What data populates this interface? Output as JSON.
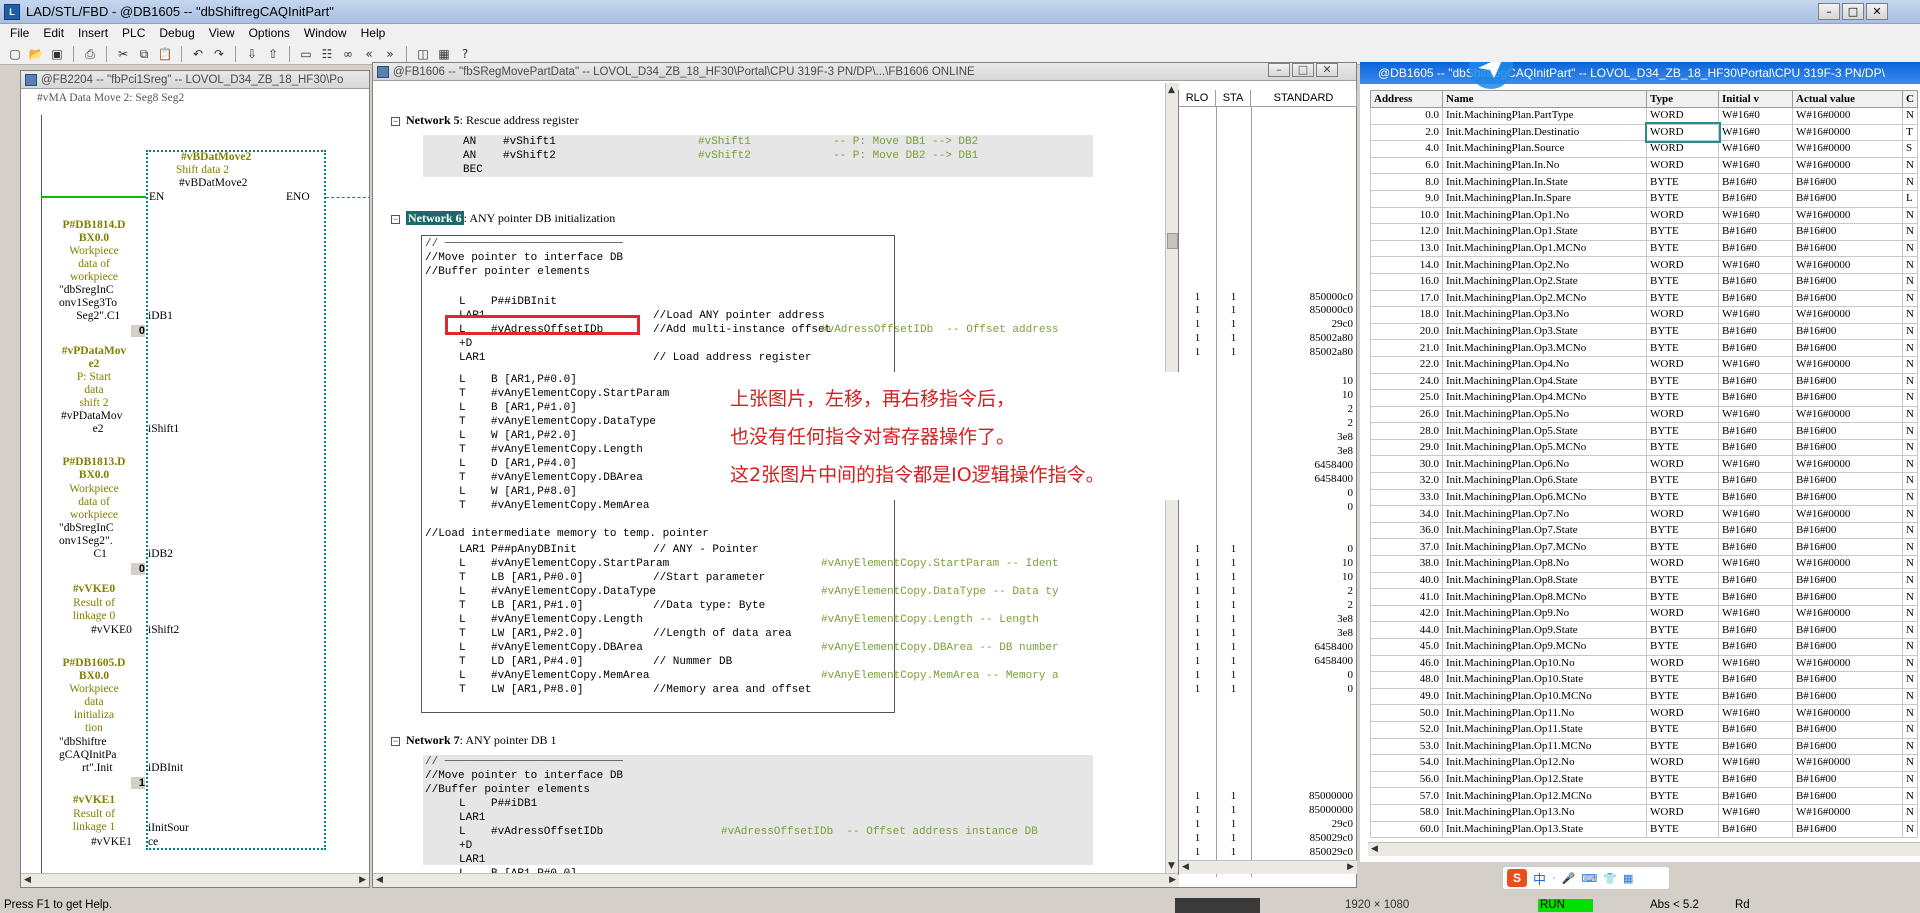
{
  "app": {
    "title": "LAD/STL/FBD  - @DB1605 -- \"dbShiftregCAQInitPart\""
  },
  "menu": [
    "File",
    "Edit",
    "Insert",
    "PLC",
    "Debug",
    "View",
    "Options",
    "Window",
    "Help"
  ],
  "left_panel": {
    "title": "@FB2204 -- \"fbPci1Sreg\" -- LOVOL_D34_ZB_18_HF30\\Po",
    "top_text": "#vMA Data Move 2: Seg8 Seg2",
    "block_name": "#vBDatMove2",
    "block_comment": "Shift data 2",
    "block_instance": "#vBDatMove2",
    "en": "EN",
    "eno": "ENO",
    "inputs": [
      {
        "symbol_lines": [
          "P#DB1814.D",
          "BX0.0"
        ],
        "comment_lines": [
          "Workpiece",
          "data of",
          "workpiece"
        ],
        "value_lines": [
          "\"dbSregInC",
          "onv1Seg3To",
          "Seg2\".C1"
        ],
        "pin": "iDB1",
        "extra": "0"
      },
      {
        "symbol_lines": [
          "#vPDataMov",
          "e2"
        ],
        "comment_lines": [
          "P: Start",
          "data",
          "shift 2"
        ],
        "value_lines": [
          "#vPDataMov",
          "e2"
        ],
        "pin": "iShift1",
        "extra": ""
      },
      {
        "symbol_lines": [
          "P#DB1813.D",
          "BX0.0"
        ],
        "comment_lines": [
          "Workpiece",
          "data of",
          "workpiece"
        ],
        "value_lines": [
          "\"dbSregInC",
          "onv1Seg2\".",
          "C1"
        ],
        "pin": "iDB2",
        "extra": "0"
      },
      {
        "symbol_lines": [
          "#vVKE0"
        ],
        "comment_lines": [
          "Result of",
          "linkage 0"
        ],
        "value_lines": [
          "#vVKE0"
        ],
        "pin": "iShift2",
        "extra": ""
      },
      {
        "symbol_lines": [
          "P#DB1605.D",
          "BX0.0"
        ],
        "comment_lines": [
          "Workpiece",
          "data",
          "initializa",
          "tion"
        ],
        "value_lines": [
          "\"dbShiftre",
          "gCAQInitPa",
          "rt\".Init"
        ],
        "pin": "iDBInit",
        "extra": "1"
      },
      {
        "symbol_lines": [
          "#vVKE1"
        ],
        "comment_lines": [
          "Result of",
          "linkage 1"
        ],
        "value_lines": [
          "#vVKE1"
        ],
        "pin": "iInitSour",
        "extra": "ce"
      }
    ]
  },
  "code_panel": {
    "title": "@FB1606 -- \"fbSRegMovePartData\" -- LOVOL_D34_ZB_18_HF30\\Portal\\CPU 319F-3 PN/DP\\...\\FB1606  ONLINE",
    "status_headers": [
      "RLO",
      "STA",
      "STANDARD"
    ],
    "network5": {
      "label": "Network 5",
      "title": ": Rescue address register",
      "lines": [
        {
          "op": "AN",
          "arg": "#vShift1",
          "sym": "#vShift1",
          "cmt": "-- P: Move DB1 --> DB2"
        },
        {
          "op": "AN",
          "arg": "#vShift2",
          "sym": "#vShift2",
          "cmt": "-- P: Move DB2 --> DB1"
        },
        {
          "op": "BEC",
          "arg": "",
          "sym": "",
          "cmt": ""
        }
      ]
    },
    "network6": {
      "label": "Network 6",
      "title": ": ANY pointer DB initialization",
      "comment_lines": [
        "// ───────────────────────────",
        "//Move pointer to interface DB",
        "//Buffer pointer elements"
      ],
      "lines": [
        {
          "op": "L",
          "arg": "P##iDBInit",
          "cmt": "",
          "sym": ""
        },
        {
          "op": "LAR1",
          "arg": "",
          "cmt": "//Load ANY pointer address",
          "sym": ""
        },
        {
          "op": "L",
          "arg": "#vAdressOffsetIDb",
          "cmt": "//Add multi-instance offset",
          "sym": "#vAdressOffsetIDb  -- Offset address"
        },
        {
          "op": "+D",
          "arg": "",
          "cmt": "",
          "sym": ""
        },
        {
          "op": "LAR1",
          "arg": "",
          "cmt": "// Load address register",
          "sym": ""
        },
        {
          "op": "L",
          "arg": "B [AR1,P#0.0]",
          "cmt": "",
          "sym": ""
        },
        {
          "op": "T",
          "arg": "#vAnyElementCopy.StartParam",
          "cmt": "",
          "sym": ""
        },
        {
          "op": "L",
          "arg": "B [AR1,P#1.0]",
          "cmt": "",
          "sym": ""
        },
        {
          "op": "T",
          "arg": "#vAnyElementCopy.DataType",
          "cmt": "",
          "sym": ""
        },
        {
          "op": "L",
          "arg": "W [AR1,P#2.0]",
          "cmt": "",
          "sym": ""
        },
        {
          "op": "T",
          "arg": "#vAnyElementCopy.Length",
          "cmt": "",
          "sym": ""
        },
        {
          "op": "L",
          "arg": "D [AR1,P#4.0]",
          "cmt": "",
          "sym": ""
        },
        {
          "op": "T",
          "arg": "#vAnyElementCopy.DBArea",
          "cmt": "",
          "sym": ""
        },
        {
          "op": "L",
          "arg": "W [AR1,P#8.0]",
          "cmt": "",
          "sym": ""
        },
        {
          "op": "T",
          "arg": "#vAnyElementCopy.MemArea",
          "cmt": "",
          "sym": ""
        }
      ],
      "comment2": "//Load intermediate memory to temp. pointer",
      "lines2": [
        {
          "op": "LAR1",
          "arg": "P##pAnyDBInit",
          "cmt": "// ANY - Pointer",
          "sym": ""
        },
        {
          "op": "L",
          "arg": "#vAnyElementCopy.StartParam",
          "cmt": "",
          "sym": "#vAnyElementCopy.StartParam -- Ident"
        },
        {
          "op": "T",
          "arg": "LB [AR1,P#0.0]",
          "cmt": "//Start parameter",
          "sym": ""
        },
        {
          "op": "L",
          "arg": "#vAnyElementCopy.DataType",
          "cmt": "",
          "sym": "#vAnyElementCopy.DataType -- Data ty"
        },
        {
          "op": "T",
          "arg": "LB [AR1,P#1.0]",
          "cmt": "//Data type: Byte",
          "sym": ""
        },
        {
          "op": "L",
          "arg": "#vAnyElementCopy.Length",
          "cmt": "",
          "sym": "#vAnyElementCopy.Length -- Length"
        },
        {
          "op": "T",
          "arg": "LW [AR1,P#2.0]",
          "cmt": "//Length of data area",
          "sym": ""
        },
        {
          "op": "L",
          "arg": "#vAnyElementCopy.DBArea",
          "cmt": "",
          "sym": "#vAnyElementCopy.DBArea -- DB number"
        },
        {
          "op": "T",
          "arg": "LD [AR1,P#4.0]",
          "cmt": "// Nummer DB",
          "sym": ""
        },
        {
          "op": "L",
          "arg": "#vAnyElementCopy.MemArea",
          "cmt": "",
          "sym": "#vAnyElementCopy.MemArea -- Memory a"
        },
        {
          "op": "T",
          "arg": "LW [AR1,P#8.0]",
          "cmt": "//Memory area and offset",
          "sym": ""
        }
      ]
    },
    "network7": {
      "label": "Network 7",
      "title": ": ANY pointer DB 1",
      "comment_lines": [
        "// ───────────────────────────",
        "//Move pointer to interface DB",
        "//Buffer pointer elements"
      ],
      "lines": [
        {
          "op": "L",
          "arg": "P##iDB1",
          "sym": ""
        },
        {
          "op": "LAR1",
          "arg": "",
          "sym": ""
        },
        {
          "op": "L",
          "arg": "#vAdressOffsetIDb",
          "sym": "#vAdressOffsetIDb  -- Offset address instance DB"
        },
        {
          "op": "+D",
          "arg": "",
          "sym": ""
        },
        {
          "op": "LAR1",
          "arg": "",
          "sym": ""
        },
        {
          "op": "L",
          "arg": "B [AR1,P#0.0]",
          "sym": ""
        }
      ]
    },
    "status_rows": [
      {
        "rlo": "1",
        "sta": "1",
        "std": "850000c0"
      },
      {
        "rlo": "1",
        "sta": "1",
        "std": "850000c0"
      },
      {
        "rlo": "1",
        "sta": "1",
        "std": "29c0"
      },
      {
        "rlo": "1",
        "sta": "1",
        "std": "85002a80"
      },
      {
        "rlo": "1",
        "sta": "1",
        "std": "85002a80"
      },
      {
        "rlo": "",
        "sta": "",
        "std": "10"
      },
      {
        "rlo": "",
        "sta": "",
        "std": "10"
      },
      {
        "rlo": "",
        "sta": "",
        "std": "2"
      },
      {
        "rlo": "",
        "sta": "",
        "std": "2"
      },
      {
        "rlo": "",
        "sta": "",
        "std": "3e8"
      },
      {
        "rlo": "",
        "sta": "",
        "std": "3e8"
      },
      {
        "rlo": "",
        "sta": "",
        "std": "6458400"
      },
      {
        "rlo": "",
        "sta": "",
        "std": "6458400"
      },
      {
        "rlo": "",
        "sta": "",
        "std": "0"
      },
      {
        "rlo": "",
        "sta": "",
        "std": "0"
      },
      {
        "rlo": "1",
        "sta": "1",
        "std": "0"
      },
      {
        "rlo": "1",
        "sta": "1",
        "std": "10"
      },
      {
        "rlo": "1",
        "sta": "1",
        "std": "10"
      },
      {
        "rlo": "1",
        "sta": "1",
        "std": "2"
      },
      {
        "rlo": "1",
        "sta": "1",
        "std": "2"
      },
      {
        "rlo": "1",
        "sta": "1",
        "std": "3e8"
      },
      {
        "rlo": "1",
        "sta": "1",
        "std": "3e8"
      },
      {
        "rlo": "1",
        "sta": "1",
        "std": "6458400"
      },
      {
        "rlo": "1",
        "sta": "1",
        "std": "6458400"
      },
      {
        "rlo": "1",
        "sta": "1",
        "std": "0"
      },
      {
        "rlo": "1",
        "sta": "1",
        "std": "0"
      }
    ],
    "status_rows_n7": [
      {
        "rlo": "1",
        "sta": "1",
        "std": "85000000"
      },
      {
        "rlo": "1",
        "sta": "1",
        "std": "85000000"
      },
      {
        "rlo": "1",
        "sta": "1",
        "std": "29c0"
      },
      {
        "rlo": "1",
        "sta": "1",
        "std": "850029c0"
      },
      {
        "rlo": "1",
        "sta": "1",
        "std": "850029c0"
      }
    ]
  },
  "annotation": {
    "lines": [
      "上张图片，左移，再右移指令后，",
      "也没有任何指令对寄存器操作了。",
      "这2张图片中间的指令都是IO逻辑操作指令。"
    ]
  },
  "db_panel": {
    "title": "@DB1605 -- \"dbShiftregCAQInitPart\" -- LOVOL_D34_ZB_18_HF30\\Portal\\CPU 319F-3 PN/DP\\",
    "headers": [
      "Address",
      "Name",
      "Type",
      "Initial v",
      "Actual value",
      "C"
    ],
    "rows": [
      [
        "0.0",
        "Init.MachiningPlan.PartType",
        "WORD",
        "W#16#0",
        "W#16#0000",
        "N"
      ],
      [
        "2.0",
        "Init.MachiningPlan.Destinatio",
        "WORD",
        "W#16#0",
        "W#16#0000",
        "T"
      ],
      [
        "4.0",
        "Init.MachiningPlan.Source",
        "WORD",
        "W#16#0",
        "W#16#0000",
        "S"
      ],
      [
        "6.0",
        "Init.MachiningPlan.In.No",
        "WORD",
        "W#16#0",
        "W#16#0000",
        "N"
      ],
      [
        "8.0",
        "Init.MachiningPlan.In.State",
        "BYTE",
        "B#16#0",
        "B#16#00",
        "N"
      ],
      [
        "9.0",
        "Init.MachiningPlan.In.Spare",
        "BYTE",
        "B#16#0",
        "B#16#00",
        "L"
      ],
      [
        "10.0",
        "Init.MachiningPlan.Op1.No",
        "WORD",
        "W#16#0",
        "W#16#0000",
        "N"
      ],
      [
        "12.0",
        "Init.MachiningPlan.Op1.State",
        "BYTE",
        "B#16#0",
        "B#16#00",
        "N"
      ],
      [
        "13.0",
        "Init.MachiningPlan.Op1.MCNo",
        "BYTE",
        "B#16#0",
        "B#16#00",
        "N"
      ],
      [
        "14.0",
        "Init.MachiningPlan.Op2.No",
        "WORD",
        "W#16#0",
        "W#16#0000",
        "N"
      ],
      [
        "16.0",
        "Init.MachiningPlan.Op2.State",
        "BYTE",
        "B#16#0",
        "B#16#00",
        "N"
      ],
      [
        "17.0",
        "Init.MachiningPlan.Op2.MCNo",
        "BYTE",
        "B#16#0",
        "B#16#00",
        "N"
      ],
      [
        "18.0",
        "Init.MachiningPlan.Op3.No",
        "WORD",
        "W#16#0",
        "W#16#0000",
        "N"
      ],
      [
        "20.0",
        "Init.MachiningPlan.Op3.State",
        "BYTE",
        "B#16#0",
        "B#16#00",
        "N"
      ],
      [
        "21.0",
        "Init.MachiningPlan.Op3.MCNo",
        "BYTE",
        "B#16#0",
        "B#16#00",
        "N"
      ],
      [
        "22.0",
        "Init.MachiningPlan.Op4.No",
        "WORD",
        "W#16#0",
        "W#16#0000",
        "N"
      ],
      [
        "24.0",
        "Init.MachiningPlan.Op4.State",
        "BYTE",
        "B#16#0",
        "B#16#00",
        "N"
      ],
      [
        "25.0",
        "Init.MachiningPlan.Op4.MCNo",
        "BYTE",
        "B#16#0",
        "B#16#00",
        "N"
      ],
      [
        "26.0",
        "Init.MachiningPlan.Op5.No",
        "WORD",
        "W#16#0",
        "W#16#0000",
        "N"
      ],
      [
        "28.0",
        "Init.MachiningPlan.Op5.State",
        "BYTE",
        "B#16#0",
        "B#16#00",
        "N"
      ],
      [
        "29.0",
        "Init.MachiningPlan.Op5.MCNo",
        "BYTE",
        "B#16#0",
        "B#16#00",
        "N"
      ],
      [
        "30.0",
        "Init.MachiningPlan.Op6.No",
        "WORD",
        "W#16#0",
        "W#16#0000",
        "N"
      ],
      [
        "32.0",
        "Init.MachiningPlan.Op6.State",
        "BYTE",
        "B#16#0",
        "B#16#00",
        "N"
      ],
      [
        "33.0",
        "Init.MachiningPlan.Op6.MCNo",
        "BYTE",
        "B#16#0",
        "B#16#00",
        "N"
      ],
      [
        "34.0",
        "Init.MachiningPlan.Op7.No",
        "WORD",
        "W#16#0",
        "W#16#0000",
        "N"
      ],
      [
        "36.0",
        "Init.MachiningPlan.Op7.State",
        "BYTE",
        "B#16#0",
        "B#16#00",
        "N"
      ],
      [
        "37.0",
        "Init.MachiningPlan.Op7.MCNo",
        "BYTE",
        "B#16#0",
        "B#16#00",
        "N"
      ],
      [
        "38.0",
        "Init.MachiningPlan.Op8.No",
        "WORD",
        "W#16#0",
        "W#16#0000",
        "N"
      ],
      [
        "40.0",
        "Init.MachiningPlan.Op8.State",
        "BYTE",
        "B#16#0",
        "B#16#00",
        "N"
      ],
      [
        "41.0",
        "Init.MachiningPlan.Op8.MCNo",
        "BYTE",
        "B#16#0",
        "B#16#00",
        "N"
      ],
      [
        "42.0",
        "Init.MachiningPlan.Op9.No",
        "WORD",
        "W#16#0",
        "W#16#0000",
        "N"
      ],
      [
        "44.0",
        "Init.MachiningPlan.Op9.State",
        "BYTE",
        "B#16#0",
        "B#16#00",
        "N"
      ],
      [
        "45.0",
        "Init.MachiningPlan.Op9.MCNo",
        "BYTE",
        "B#16#0",
        "B#16#00",
        "N"
      ],
      [
        "46.0",
        "Init.MachiningPlan.Op10.No",
        "WORD",
        "W#16#0",
        "W#16#0000",
        "N"
      ],
      [
        "48.0",
        "Init.MachiningPlan.Op10.State",
        "BYTE",
        "B#16#0",
        "B#16#00",
        "N"
      ],
      [
        "49.0",
        "Init.MachiningPlan.Op10.MCNo",
        "BYTE",
        "B#16#0",
        "B#16#00",
        "N"
      ],
      [
        "50.0",
        "Init.MachiningPlan.Op11.No",
        "WORD",
        "W#16#0",
        "W#16#0000",
        "N"
      ],
      [
        "52.0",
        "Init.MachiningPlan.Op11.State",
        "BYTE",
        "B#16#0",
        "B#16#00",
        "N"
      ],
      [
        "53.0",
        "Init.MachiningPlan.Op11.MCNo",
        "BYTE",
        "B#16#0",
        "B#16#00",
        "N"
      ],
      [
        "54.0",
        "Init.MachiningPlan.Op12.No",
        "WORD",
        "W#16#0",
        "W#16#0000",
        "N"
      ],
      [
        "56.0",
        "Init.MachiningPlan.Op12.State",
        "BYTE",
        "B#16#0",
        "B#16#00",
        "N"
      ],
      [
        "57.0",
        "Init.MachiningPlan.Op12.MCNo",
        "BYTE",
        "B#16#0",
        "B#16#00",
        "N"
      ],
      [
        "58.0",
        "Init.MachiningPlan.Op13.No",
        "WORD",
        "W#16#0",
        "W#16#0000",
        "N"
      ],
      [
        "60.0",
        "Init.MachiningPlan.Op13.State",
        "BYTE",
        "B#16#0",
        "B#16#00",
        "N"
      ]
    ]
  },
  "statusbar": {
    "help": "Press F1 to get Help.",
    "resolution": "1920 × 1080",
    "run": "RUN",
    "abs": "Abs < 5.2",
    "rd": "Rd"
  },
  "tray": {
    "ime": "中"
  },
  "colors": {
    "accent_blue": "#0a64d8",
    "annotation_red": "#d42020",
    "olive": "#808000",
    "highlight_green": "#00a000"
  }
}
